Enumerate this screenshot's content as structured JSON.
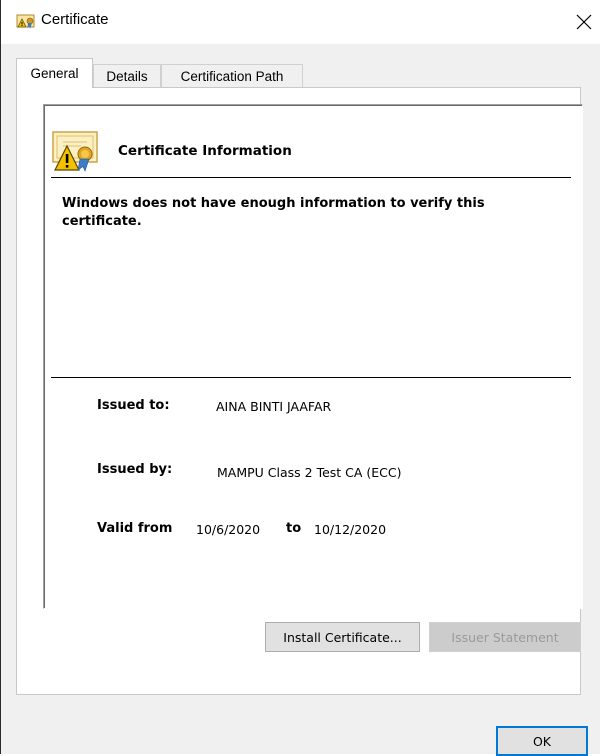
{
  "window": {
    "title": "Certificate",
    "close_glyph": "✕"
  },
  "tabs": [
    {
      "label": "General",
      "active": true
    },
    {
      "label": "Details",
      "active": false
    },
    {
      "label": "Certification Path",
      "active": false
    }
  ],
  "info": {
    "heading": "Certificate Information",
    "warning": "Windows does not have enough information to verify this certificate.",
    "issued_to_label": "Issued to:",
    "issued_to_value": "AINA BINTI JAAFAR",
    "issued_by_label": "Issued by:",
    "issued_by_value": "MAMPU Class 2 Test CA (ECC)",
    "valid_from_label": "Valid from",
    "valid_from_value": "10/6/2020",
    "valid_to_label": "to",
    "valid_to_value": "10/12/2020"
  },
  "buttons": {
    "install": "Install Certificate...",
    "issuer_statement": "Issuer Statement",
    "ok": "OK"
  },
  "icons": {
    "title": "certificate-icon",
    "info": "certificate-warning-icon",
    "close": "close-icon"
  },
  "colors": {
    "accent": "#0078d7",
    "warning_yellow": "#f2c200",
    "ribbon_blue": "#3d7cc9"
  }
}
